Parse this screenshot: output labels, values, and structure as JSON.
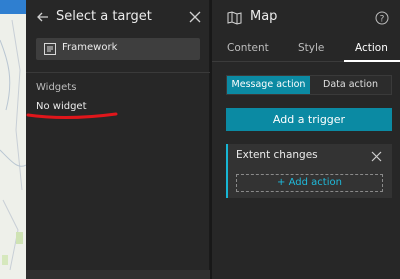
{
  "selection_panel": {
    "title": "Select a target",
    "framework_label": "Framework",
    "widgets_heading": "Widgets",
    "no_widget_text": "No widget"
  },
  "settings_panel": {
    "title": "Map",
    "tabs": [
      {
        "label": "Content",
        "active": false
      },
      {
        "label": "Style",
        "active": false
      },
      {
        "label": "Action",
        "active": true
      }
    ],
    "toggle": {
      "message_action": "Message action",
      "data_action": "Data action",
      "selected": "Message action"
    },
    "add_trigger_label": "Add a trigger",
    "trigger_card": {
      "title": "Extent changes",
      "add_action_label": "+ Add action"
    }
  },
  "colors": {
    "accent": "#0b8aa3",
    "accent_bright": "#17b6d4",
    "annotation": "#e0161b"
  }
}
